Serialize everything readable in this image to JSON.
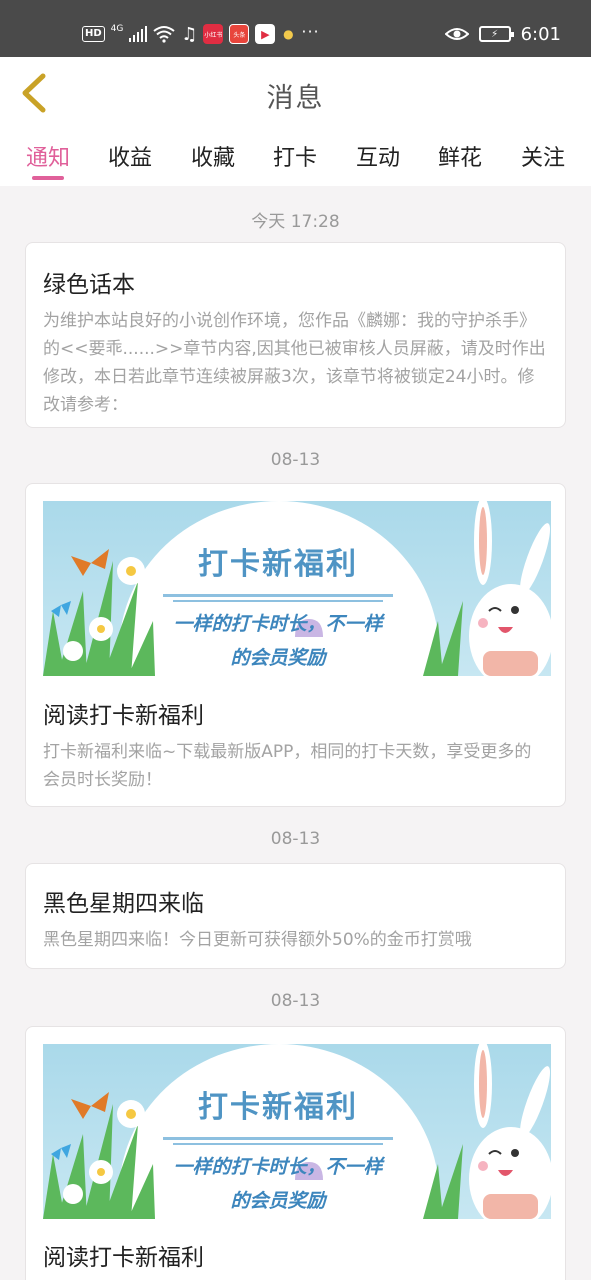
{
  "status_bar": {
    "hd": "HD",
    "network": "4G",
    "apps": [
      {
        "icon": "music-icon",
        "label": "♫",
        "color": "#4a4a4a"
      },
      {
        "icon": "xiaohongshu-app-icon",
        "label": "小红书",
        "color": "#e02d42"
      },
      {
        "icon": "toutiao-app-icon",
        "label": "头条",
        "color": "#e8453c"
      },
      {
        "icon": "video-app-icon",
        "label": "▶",
        "color": "#ffffff"
      },
      {
        "icon": "bulb-app-icon",
        "label": "●",
        "color": "#f2c94c"
      }
    ],
    "more": "···",
    "time": "6:01"
  },
  "header": {
    "back_icon": "chevron-left-icon",
    "title": "消息"
  },
  "tabs": [
    {
      "label": "通知",
      "active": true
    },
    {
      "label": "收益",
      "active": false
    },
    {
      "label": "收藏",
      "active": false
    },
    {
      "label": "打卡",
      "active": false
    },
    {
      "label": "互动",
      "active": false
    },
    {
      "label": "鲜花",
      "active": false
    },
    {
      "label": "关注",
      "active": false
    }
  ],
  "colors": {
    "accent": "#e0609a",
    "back_arrow": "#c9a227"
  },
  "messages": [
    {
      "date": "今天 17:28",
      "title": "绿色话本",
      "body": "为维护本站良好的小说创作环境，您作品《麟娜：我的守护杀手》的<<要乖......>>章节内容,因其他已被审核人员屏蔽，请及时作出修改，本日若此章节连续被屏蔽3次，该章节将被锁定24小时。修改请参考："
    },
    {
      "date": "08-13",
      "banner": {
        "headline": "打卡新福利",
        "line1": "一样的打卡时长，不一样",
        "line2": "的会员奖励"
      },
      "title": "阅读打卡新福利",
      "body": "打卡新福利来临~下载最新版APP，相同的打卡天数，享受更多的会员时长奖励！"
    },
    {
      "date": "08-13",
      "title": "黑色星期四来临",
      "body": "黑色星期四来临！今日更新可获得额外50%的金币打赏哦"
    },
    {
      "date": "08-13",
      "banner": {
        "headline": "打卡新福利",
        "line1": "一样的打卡时长，不一样",
        "line2": "的会员奖励"
      },
      "title": "阅读打卡新福利"
    }
  ]
}
